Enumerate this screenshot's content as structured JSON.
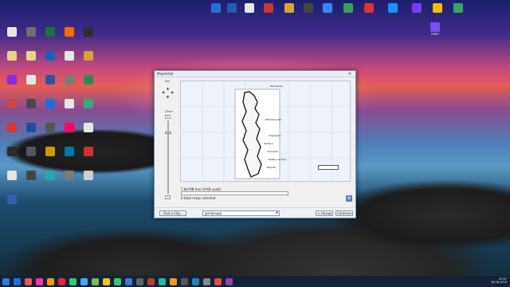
{
  "desktop_icons": [
    {
      "label": "",
      "color": "#2d6cdf"
    },
    {
      "label": "",
      "color": "#1e5eb3"
    },
    {
      "label": "",
      "color": "#e6e6e6"
    },
    {
      "label": "",
      "color": "#c33"
    },
    {
      "label": "",
      "color": "#d9a23a"
    },
    {
      "label": "",
      "color": "#444"
    },
    {
      "label": "",
      "color": "#3a86ff"
    },
    {
      "label": "",
      "color": "#3c9c5c"
    },
    {
      "label": "",
      "color": "#d33"
    },
    {
      "label": "",
      "color": "#1f8fff"
    },
    {
      "label": "",
      "color": "#7a3cff"
    },
    {
      "label": "",
      "color": "#f0c000"
    },
    {
      "label": "",
      "color": "#3ba55c"
    },
    {
      "label": "Viber",
      "color": "#7b4df3"
    },
    {
      "label": "",
      "color": "#e6e6e6"
    },
    {
      "label": "",
      "color": "#6f6f6f"
    },
    {
      "label": "",
      "color": "#1f6f3f"
    },
    {
      "label": "",
      "color": "#ff6a00"
    },
    {
      "label": "",
      "color": "#2e2e2e"
    },
    {
      "label": "",
      "color": "#e8d48a"
    },
    {
      "label": "",
      "color": "#e8d48a"
    },
    {
      "label": "",
      "color": "#1f5fb5"
    },
    {
      "label": "",
      "color": "#e6e6e6"
    },
    {
      "label": "",
      "color": "#d9a23a"
    },
    {
      "label": "",
      "color": "#8a2be2"
    },
    {
      "label": "",
      "color": "#e6e6e6"
    },
    {
      "label": "",
      "color": "#2b579a"
    },
    {
      "label": "",
      "color": "#7a7a7a"
    },
    {
      "label": "",
      "color": "#2e8b57"
    },
    {
      "label": "",
      "color": "#c44"
    },
    {
      "label": "",
      "color": "#4a4a4a"
    },
    {
      "label": "",
      "color": "#1e6fd9"
    },
    {
      "label": "",
      "color": "#e6e6e6"
    },
    {
      "label": "",
      "color": "#3a7"
    },
    {
      "label": "",
      "color": "#d33"
    },
    {
      "label": "",
      "color": "#1f4f9f"
    },
    {
      "label": "",
      "color": "#555"
    },
    {
      "label": "",
      "color": "#f06"
    },
    {
      "label": "",
      "color": "#e6e6e6"
    },
    {
      "label": "",
      "color": "#2b2b2b"
    },
    {
      "label": "",
      "color": "#556"
    },
    {
      "label": "",
      "color": "#c90"
    },
    {
      "label": "",
      "color": "#07a"
    },
    {
      "label": "",
      "color": "#c33"
    },
    {
      "label": "",
      "color": "#e6e6e6"
    },
    {
      "label": "",
      "color": "#444"
    },
    {
      "label": "",
      "color": "#2aa"
    },
    {
      "label": "",
      "color": "#7a7a7a"
    },
    {
      "label": "",
      "color": "#cfcfcf"
    },
    {
      "label": "",
      "color": "#3060b0"
    }
  ],
  "dialog": {
    "title": "MapInstall",
    "close_glyph": "✕",
    "pan_label": "Pan",
    "zoom_label": "Zoom",
    "zoom_in_glyph": "+",
    "zoom_out_glyph": "−",
    "pan_arrows": {
      "up": "▲",
      "down": "▼",
      "left": "◀",
      "right": "▶"
    },
    "scale_text": "",
    "map_labels": [
      "Murmansk",
      "Petrozavodsk",
      "Volgograd",
      "Voronezh",
      "Rostov-On-Don",
      "Nalchik",
      "Samara"
    ],
    "free_space": "7.84 MB free (0 KB used)",
    "selected": "0 total maps selected",
    "progress": 0.0,
    "bottom": {
      "find_city_label": "Find a City...",
      "select_value": "gmapsupp",
      "back_label": "< Назад",
      "continue_label": "Continue"
    }
  },
  "taskbar": {
    "apps": [
      "#1f6fd9",
      "#e55",
      "#f3a",
      "#ff9800",
      "#e23",
      "#3c6",
      "#4aa3ff",
      "#7b5",
      "#fbc02d",
      "#2ecc71",
      "#3a7bd5",
      "#666",
      "#c0392b",
      "#1abc9c",
      "#f39c12",
      "#555",
      "#2980b9",
      "#888",
      "#e74c3c",
      "#8e44ad"
    ],
    "time": "22:07",
    "date": "16.06.2016"
  }
}
